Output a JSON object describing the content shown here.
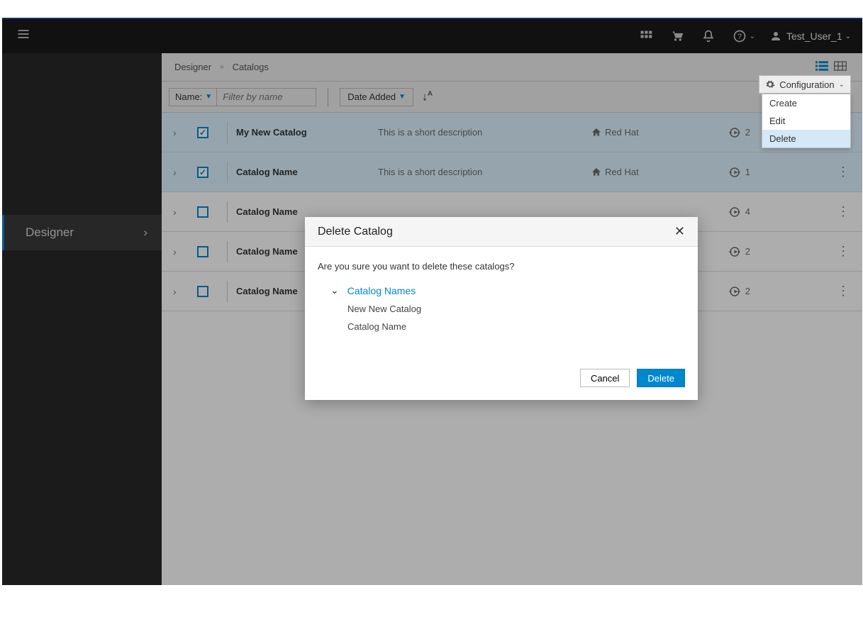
{
  "nav": {
    "user_name": "Test_User_1"
  },
  "sidebar": {
    "item_label": "Designer"
  },
  "crumbs": {
    "a": "Designer",
    "b": "Catalogs"
  },
  "toolbar": {
    "filter_label": "Name:",
    "filter_placeholder": "Filter by name",
    "sort_label": "Date Added",
    "config_label": "Configuration",
    "menu": {
      "create": "Create",
      "edit": "Edit",
      "delete": "Delete"
    }
  },
  "rows": [
    {
      "name": "My New Catalog",
      "desc": "This is a short description",
      "org": "Red Hat",
      "count": "2",
      "checked": true
    },
    {
      "name": "Catalog Name",
      "desc": "This is a short description",
      "org": "Red Hat",
      "count": "1",
      "checked": true
    },
    {
      "name": "Catalog Name",
      "desc": "",
      "org": "",
      "count": "4",
      "checked": false
    },
    {
      "name": "Catalog Name",
      "desc": "",
      "org": "",
      "count": "2",
      "checked": false
    },
    {
      "name": "Catalog Name",
      "desc": "",
      "org": "",
      "count": "2",
      "checked": false
    }
  ],
  "modal": {
    "title": "Delete Catalog",
    "message": "Are you sure you want to delete these catalogs?",
    "group_label": "Catalog Names",
    "items": [
      "New New Catalog",
      "Catalog Name"
    ],
    "cancel": "Cancel",
    "delete": "Delete"
  }
}
